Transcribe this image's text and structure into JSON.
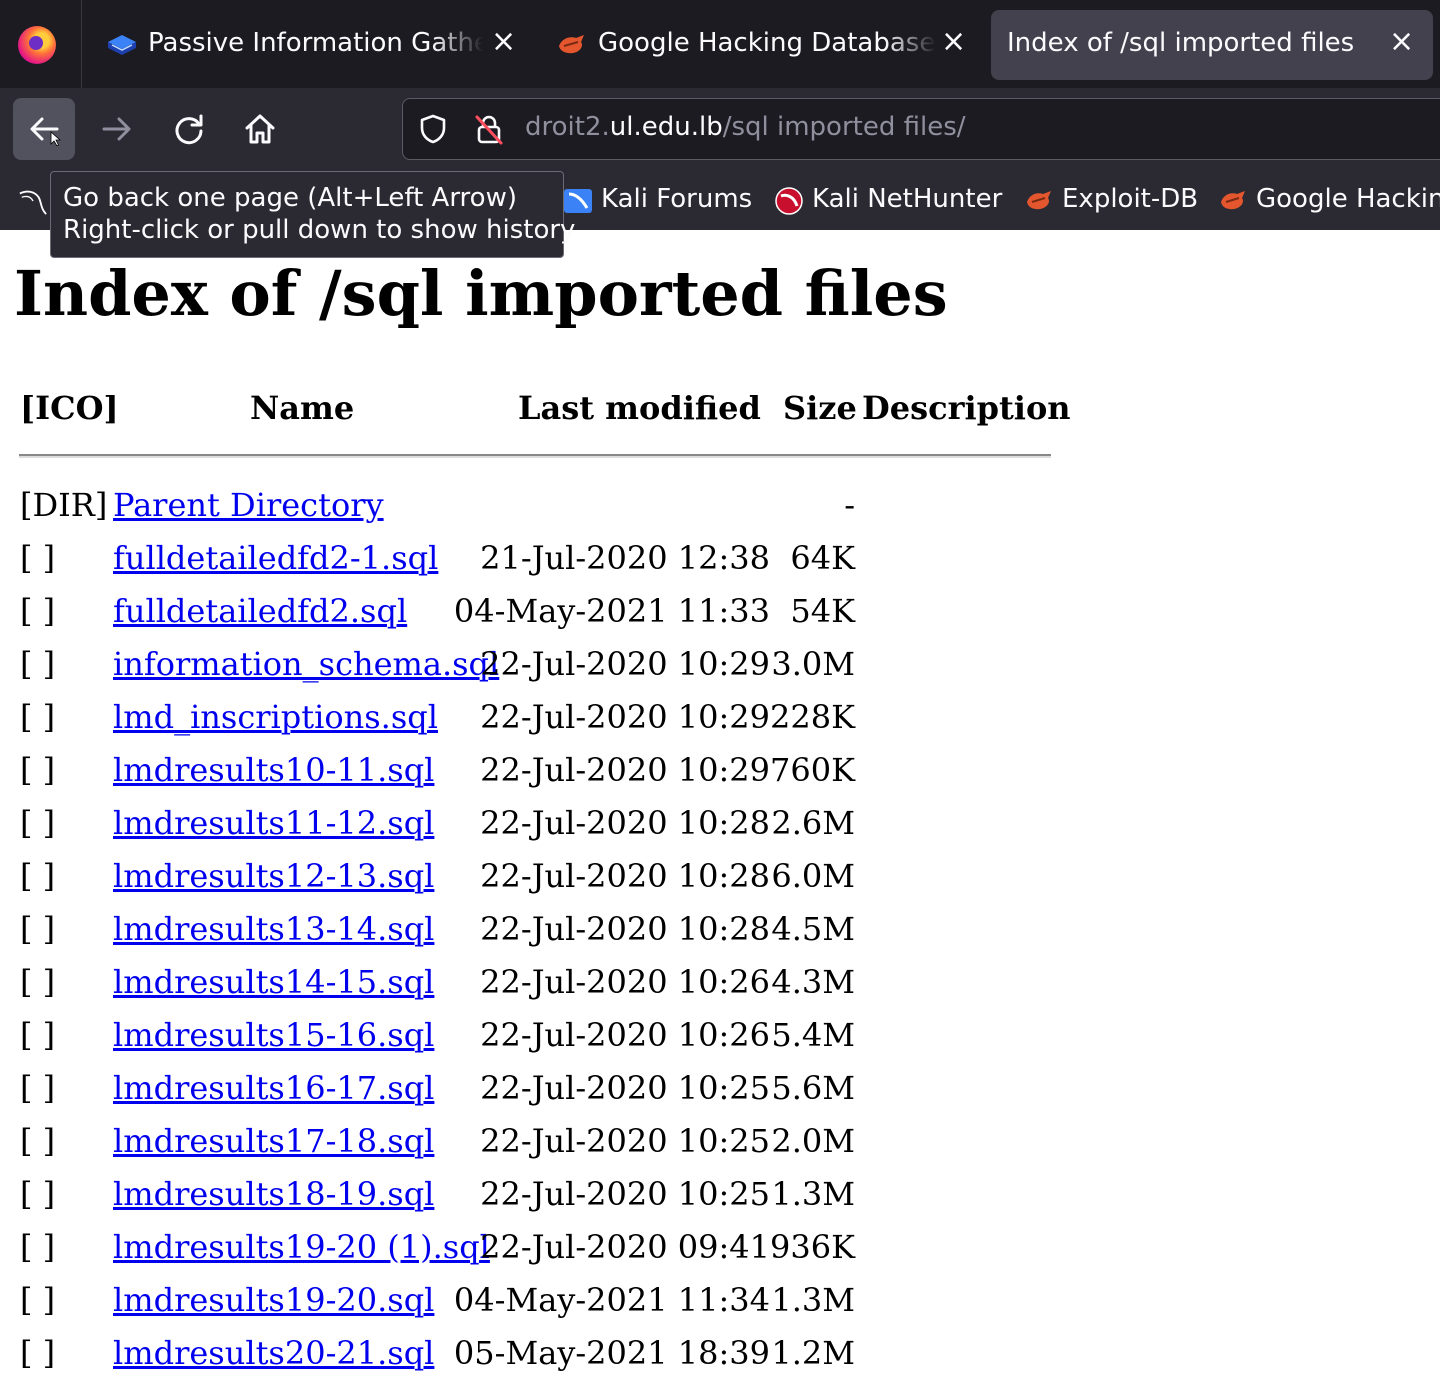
{
  "tabs": [
    {
      "title": "Passive Information Gathering",
      "close": "×"
    },
    {
      "title": "Google Hacking Database (GHDB)",
      "close": "×"
    },
    {
      "title": "Index of /sql imported files",
      "close": "×"
    }
  ],
  "urlbar": {
    "scheme": "droit2.",
    "host": "ul.edu.lb",
    "path": "/sql imported files/"
  },
  "bookmarks": [
    {
      "label": "Kali Forums"
    },
    {
      "label": "Kali NetHunter"
    },
    {
      "label": "Exploit-DB"
    },
    {
      "label": "Google Hacking DB"
    }
  ],
  "tooltip": {
    "line1": "Go back one page (Alt+Left Arrow)",
    "line2": "Right-click or pull down to show history"
  },
  "page": {
    "title": "Index of /sql imported files",
    "headers": {
      "ico": "[ICO]",
      "name": "Name",
      "modified": "Last modified",
      "size": "Size",
      "description": "Description"
    },
    "rows": [
      {
        "ico": "[DIR]",
        "name": "Parent Directory",
        "modified": "",
        "size": "-"
      },
      {
        "ico": "[ ]",
        "name": "fulldetailedfd2-1.sql",
        "modified": "21-Jul-2020 12:38",
        "size": "64K"
      },
      {
        "ico": "[ ]",
        "name": "fulldetailedfd2.sql",
        "modified": "04-May-2021 11:33",
        "size": "54K"
      },
      {
        "ico": "[ ]",
        "name": "information_schema.sql",
        "modified": "22-Jul-2020 10:29",
        "size": "3.0M"
      },
      {
        "ico": "[ ]",
        "name": "lmd_inscriptions.sql",
        "modified": "22-Jul-2020 10:29",
        "size": "228K"
      },
      {
        "ico": "[ ]",
        "name": "lmdresults10-11.sql",
        "modified": "22-Jul-2020 10:29",
        "size": "760K"
      },
      {
        "ico": "[ ]",
        "name": "lmdresults11-12.sql",
        "modified": "22-Jul-2020 10:28",
        "size": "2.6M"
      },
      {
        "ico": "[ ]",
        "name": "lmdresults12-13.sql",
        "modified": "22-Jul-2020 10:28",
        "size": "6.0M"
      },
      {
        "ico": "[ ]",
        "name": "lmdresults13-14.sql",
        "modified": "22-Jul-2020 10:28",
        "size": "4.5M"
      },
      {
        "ico": "[ ]",
        "name": "lmdresults14-15.sql",
        "modified": "22-Jul-2020 10:26",
        "size": "4.3M"
      },
      {
        "ico": "[ ]",
        "name": "lmdresults15-16.sql",
        "modified": "22-Jul-2020 10:26",
        "size": "5.4M"
      },
      {
        "ico": "[ ]",
        "name": "lmdresults16-17.sql",
        "modified": "22-Jul-2020 10:25",
        "size": "5.6M"
      },
      {
        "ico": "[ ]",
        "name": "lmdresults17-18.sql",
        "modified": "22-Jul-2020 10:25",
        "size": "2.0M"
      },
      {
        "ico": "[ ]",
        "name": "lmdresults18-19.sql",
        "modified": "22-Jul-2020 10:25",
        "size": "1.3M"
      },
      {
        "ico": "[ ]",
        "name": "lmdresults19-20 (1).sql",
        "modified": "22-Jul-2020 09:41",
        "size": "936K"
      },
      {
        "ico": "[ ]",
        "name": "lmdresults19-20.sql",
        "modified": "04-May-2021 11:34",
        "size": "1.3M"
      },
      {
        "ico": "[ ]",
        "name": "lmdresults20-21.sql",
        "modified": "05-May-2021 18:39",
        "size": "1.2M"
      }
    ]
  },
  "colors": {
    "link": "#0000ee",
    "chrome_dark": "#1c1b22",
    "chrome": "#2b2a33",
    "active_tab": "#42414d"
  }
}
